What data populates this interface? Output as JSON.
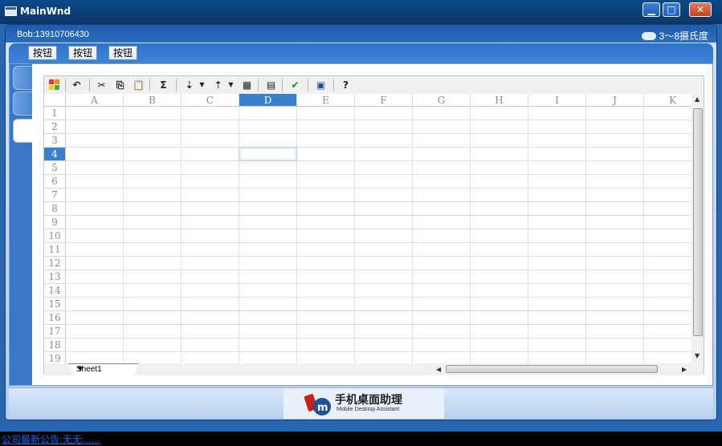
{
  "window": {
    "title": "MainWnd",
    "controls": {
      "minimize": "▁",
      "maximize": "□",
      "close": "✕"
    }
  },
  "header": {
    "user": "Bob:13910706430",
    "weather": "3～8摄氏度",
    "weather_icon": "cloud-icon"
  },
  "buttons": [
    {
      "label": "按钮"
    },
    {
      "label": "按钮"
    },
    {
      "label": "按钮"
    }
  ],
  "toolbar": {
    "icons": [
      "excel-icon",
      "undo-icon",
      "cut-icon",
      "copy-icon",
      "paste-icon",
      "sum-icon",
      "sort-asc-icon",
      "sort-desc-icon",
      "filter-icon",
      "format-icon",
      "spellcheck-icon",
      "export-icon",
      "help-icon"
    ]
  },
  "sheet": {
    "columns": [
      "A",
      "B",
      "C",
      "D",
      "E",
      "F",
      "G",
      "H",
      "I",
      "J",
      "K"
    ],
    "rows": [
      "1",
      "2",
      "3",
      "4",
      "5",
      "6",
      "7",
      "8",
      "9",
      "10",
      "11",
      "12",
      "13",
      "14",
      "15",
      "16",
      "17",
      "18",
      "19"
    ],
    "selected_column": "D",
    "selected_row": "4",
    "tab": "Sheet1"
  },
  "logo": {
    "text_cn": "手机桌面助理",
    "text_en": "Mobile Desktop Assistant"
  },
  "status": {
    "notice": "公司最新公告:无无......"
  },
  "colors": {
    "accent": "#3a7fc9",
    "title_bar": "#0d3e76",
    "frame": "#2a66b0",
    "status_link": "#1f66e8"
  }
}
